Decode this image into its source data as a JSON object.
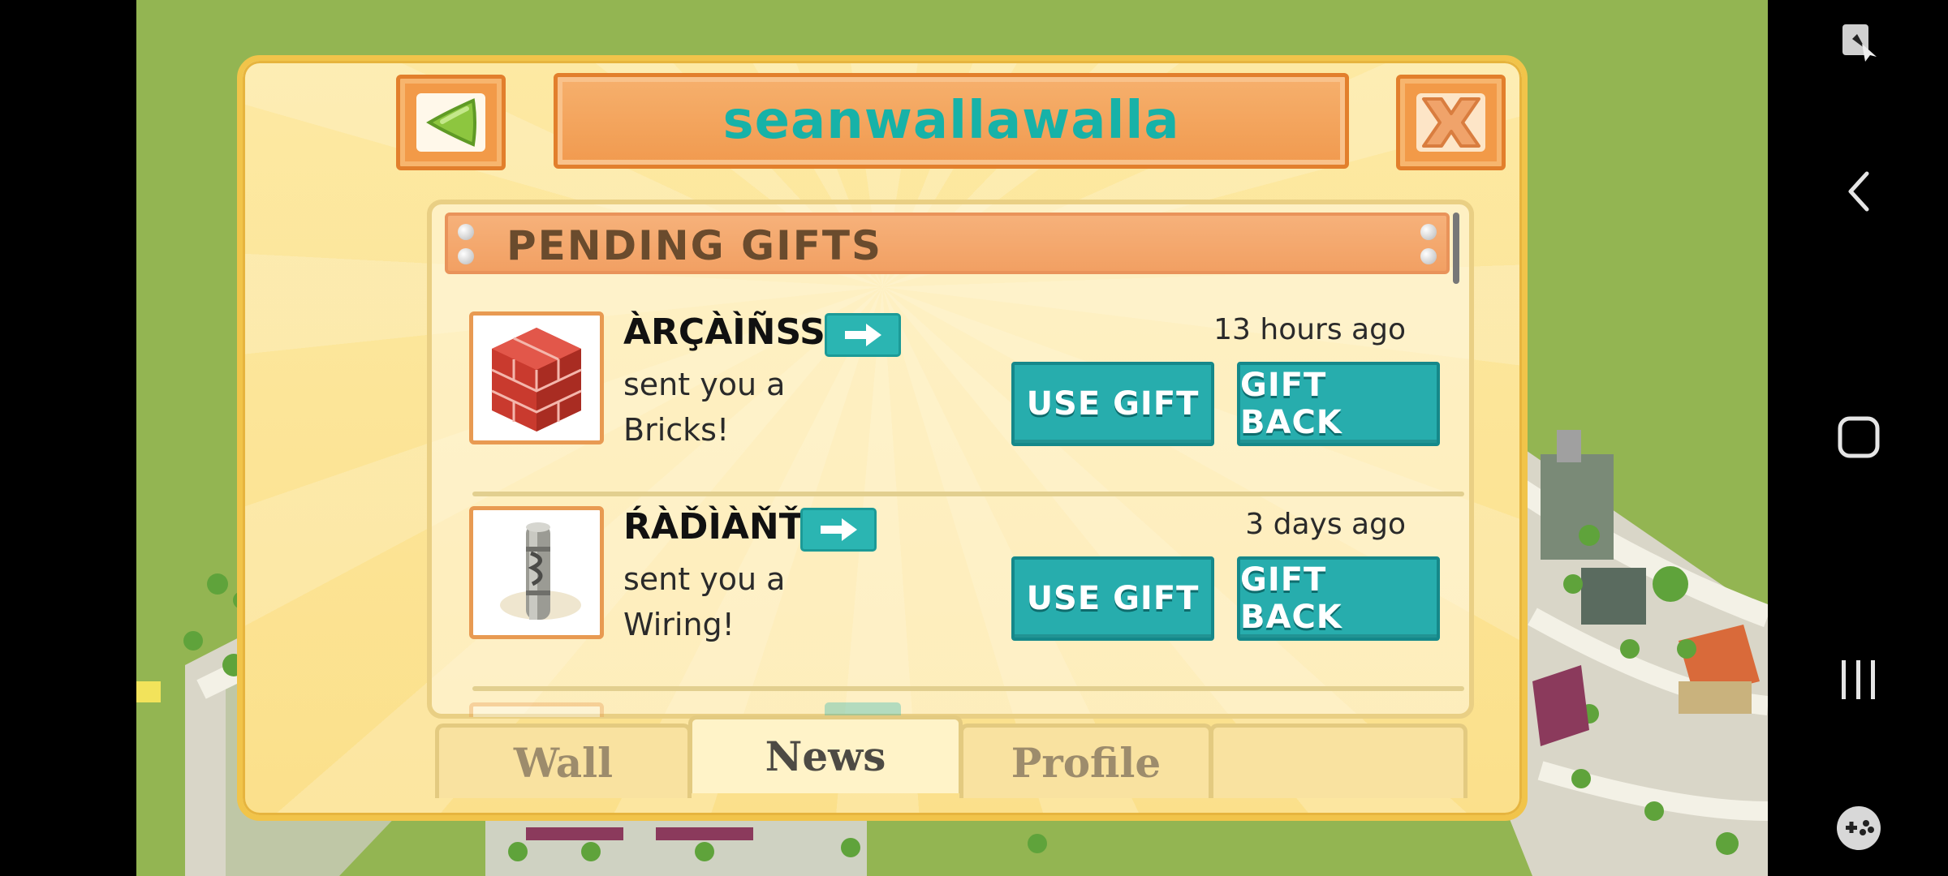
{
  "dialog": {
    "title": "seanwallawalla",
    "section_title": "PENDING GIFTS",
    "back_button": "back-arrow",
    "close_button": "close-x"
  },
  "gifts": [
    {
      "sender": "ÀRÇÀÌÑSS",
      "message_line1": "sent you a",
      "message_line2": "Bricks!",
      "time": "13 hours ago",
      "item_icon": "bricks-icon",
      "use_label": "USE GIFT",
      "back_label": "GIFT BACK"
    },
    {
      "sender": "ŔÀĎÌÀŇŤ",
      "message_line1": "sent you a",
      "message_line2": "Wiring!",
      "time": "3 days ago",
      "item_icon": "wiring-icon",
      "use_label": "USE GIFT",
      "back_label": "GIFT BACK"
    }
  ],
  "tabs": [
    {
      "label": "Wall",
      "active": false
    },
    {
      "label": "News",
      "active": true
    },
    {
      "label": "Profile",
      "active": false
    },
    {
      "label": "",
      "active": false
    }
  ],
  "system_nav": {
    "icons": [
      "screenshot-cursor-icon",
      "back-chevron-icon",
      "home-square-icon",
      "recents-icon",
      "gamepad-icon"
    ]
  },
  "colors": {
    "title_teal": "#17b2a8",
    "button_teal": "#27adad",
    "orange_bar": "#f29a48",
    "dialog_yellow": "#fde9a3",
    "grass": "#93b552"
  }
}
